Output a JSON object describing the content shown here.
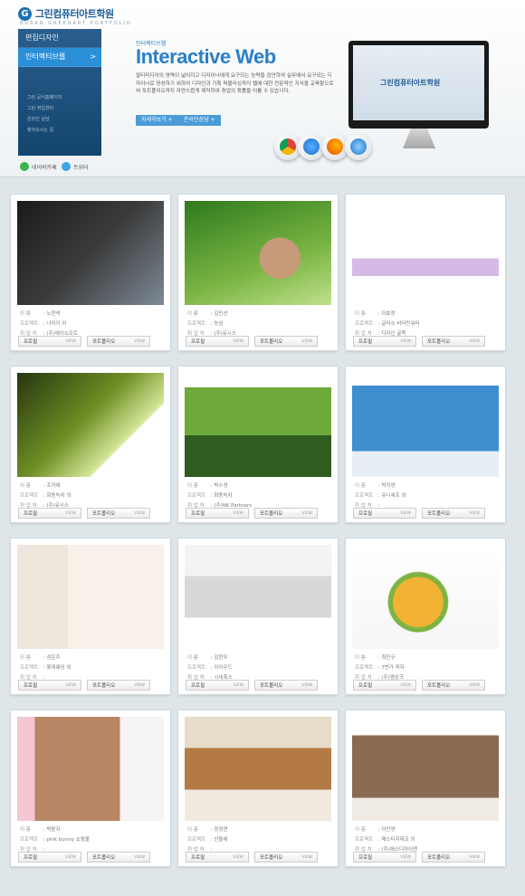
{
  "header": {
    "logo_text": "그린컴퓨터아트학원",
    "logo_sub": "BUSAN GREENART PORTFOLIO"
  },
  "sidebar": {
    "items": [
      {
        "label": "편집디자인"
      },
      {
        "label": "인터렉티브웹",
        "arrow": ">"
      }
    ],
    "sub_links": [
      "그린 공식홈페이지",
      "그린 취업센터",
      "온라인 상담",
      "찾아오시는 길"
    ],
    "sns": [
      {
        "label": "네이버카페"
      },
      {
        "label": "트위터"
      }
    ]
  },
  "hero": {
    "category": "인터렉티브웹",
    "title": "Interactive Web",
    "description": "멀티미디어의 영역이 넓어지고 디자이너에게 요구되는 능력을 감안하여 실무에서 요구되는 디자이너로 양성하기 위하여 디자인과 기획 퍼블리싱까지 웹에 대한 전문적인 지식을 교육함으로써 포트폴리오까지 자연스럽게 제작하여 취업의 확률을 이룰 수 있습니다.",
    "btn_more": "자세히보기",
    "btn_consult": "온라인상담",
    "monitor_logo": "그린컴퓨터아트학원"
  },
  "browser_icons": [
    "chrome-icon",
    "safari-icon",
    "firefox-icon",
    "ie-icon"
  ],
  "labels": {
    "name": "이 름",
    "project": "프로젝트",
    "company": "취 업 처",
    "profile_btn": "프로필",
    "portfolio_btn": "포트폴리오",
    "view": "VIEW"
  },
  "portfolios": [
    {
      "name": "노연석",
      "project": "나이키 외",
      "company": "(주)에이소프트"
    },
    {
      "name": "김민선",
      "project": "농심",
      "company": "(주)유시스"
    },
    {
      "name": "이효정",
      "project": "글라소 비타민워터",
      "company": "디자인 굴뚝"
    },
    {
      "name": "조지애",
      "project": "화동녹차 외",
      "company": "(주)유시스"
    },
    {
      "name": "박수경",
      "project": "화동녹차",
      "company": "(주)NK Partners"
    },
    {
      "name": "박지영",
      "project": "유니세프 외",
      "company": ""
    },
    {
      "name": "성은주",
      "project": "롯데웨딩 외",
      "company": ""
    },
    {
      "name": "김현우",
      "project": "이이우드",
      "company": "시네폭스"
    },
    {
      "name": "최민규",
      "project": "7번가 피자",
      "company": "(주)엠싱크"
    },
    {
      "name": "박윤지",
      "project": "pink bunny 쇼핑몰",
      "company": ""
    },
    {
      "name": "정경연",
      "project": "산들애",
      "company": ""
    },
    {
      "name": "이민영",
      "project": "매스티지데코 외",
      "company": "(주)에스디아이엔"
    }
  ]
}
